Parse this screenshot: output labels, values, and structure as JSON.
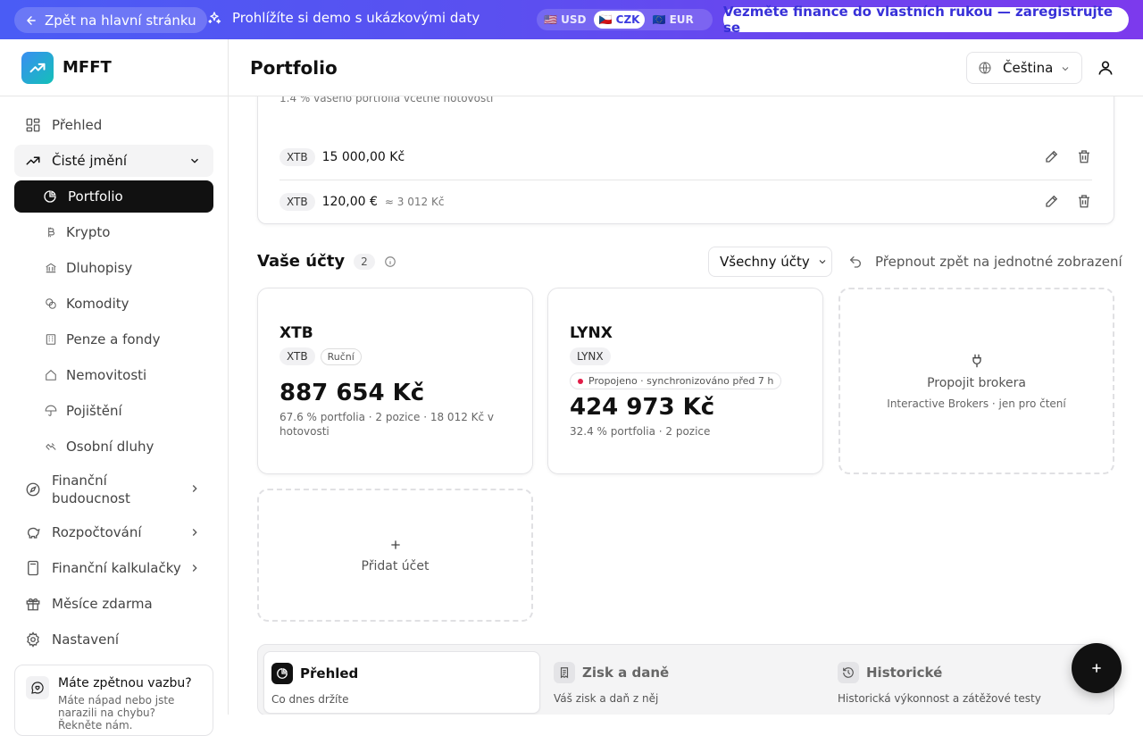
{
  "banner": {
    "back_label": "Zpět na hlavní stránku",
    "demo_text": "Prohlížíte si demo s ukázkovými daty",
    "currencies": [
      {
        "flag": "🇺🇸",
        "code": "USD"
      },
      {
        "flag": "🇨🇿",
        "code": "CZK"
      },
      {
        "flag": "🇪🇺",
        "code": "EUR"
      }
    ],
    "selected_currency": "CZK",
    "cta_label": "Vezměte finance do vlastních rukou — zaregistrujte se"
  },
  "app": {
    "name": "MFFT"
  },
  "sidebar": {
    "items": [
      {
        "label": "Přehled",
        "icon": "dashboard-icon"
      },
      {
        "label": "Čisté jmění",
        "icon": "trending-up-icon"
      },
      {
        "label": "Portfolio",
        "icon": "pie-chart-icon"
      },
      {
        "label": "Krypto",
        "icon": "bitcoin-icon"
      },
      {
        "label": "Dluhopisy",
        "icon": "bank-icon"
      },
      {
        "label": "Komodity",
        "icon": "coins-icon"
      },
      {
        "label": "Penze a fondy",
        "icon": "building-icon"
      },
      {
        "label": "Nemovitosti",
        "icon": "home-icon"
      },
      {
        "label": "Pojištění",
        "icon": "umbrella-icon"
      },
      {
        "label": "Osobní dluhy",
        "icon": "handshake-icon"
      },
      {
        "label": "Finanční budoucnost",
        "icon": "compass-icon"
      },
      {
        "label": "Rozpočtování",
        "icon": "piggy-bank-icon"
      },
      {
        "label": "Finanční kalkulačky",
        "icon": "calculator-icon"
      },
      {
        "label": "Měsíce zdarma",
        "icon": "gift-icon"
      },
      {
        "label": "Nastavení",
        "icon": "gear-icon"
      }
    ],
    "feedback": {
      "title": "Máte zpětnou vazbu?",
      "text": "Máte nápad nebo jste narazili na chybu? Řekněte nám."
    }
  },
  "header": {
    "title": "Portfolio",
    "language": "Čeština"
  },
  "cash": {
    "subtitle": "1.4 % vašeho portfolia včetně hotovosti",
    "rows": [
      {
        "broker": "XTB",
        "amount": "15 000,00 Kč",
        "converted": ""
      },
      {
        "broker": "XTB",
        "amount": "120,00 €",
        "converted": "≈ 3 012 Kč"
      }
    ]
  },
  "accounts": {
    "title": "Vaše účty",
    "count": "2",
    "filter_label": "Všechny účty",
    "switch_label": "Přepnout zpět na jednotné zobrazení",
    "cards": [
      {
        "name": "XTB",
        "tag": "XTB",
        "mode": "Ruční",
        "value": "887 654 Kč",
        "meta": "67.6 % portfolia · 2 pozice · 18 012 Kč v hotovosti"
      },
      {
        "name": "LYNX",
        "tag": "LYNX",
        "status": "Propojeno · synchronizováno před 7 h",
        "value": "424 973 Kč",
        "meta": "32.4 % portfolia · 2 pozice"
      }
    ],
    "connect": {
      "title": "Propojit brokera",
      "subtitle": "Interactive Brokers · jen pro čtení"
    },
    "add_label": "Přidat účet"
  },
  "tabs": [
    {
      "title": "Přehled",
      "subtitle": "Co dnes držíte",
      "icon": "pie-chart-icon"
    },
    {
      "title": "Zisk a daně",
      "subtitle": "Váš zisk a daň z něj",
      "icon": "receipt-icon"
    },
    {
      "title": "Historické",
      "subtitle": "Historická výkonnost a zátěžové testy",
      "icon": "history-icon"
    }
  ],
  "colors": {
    "accent": "#4f46e5",
    "active_nav": "#111111",
    "status_dot": "#e11d48"
  }
}
